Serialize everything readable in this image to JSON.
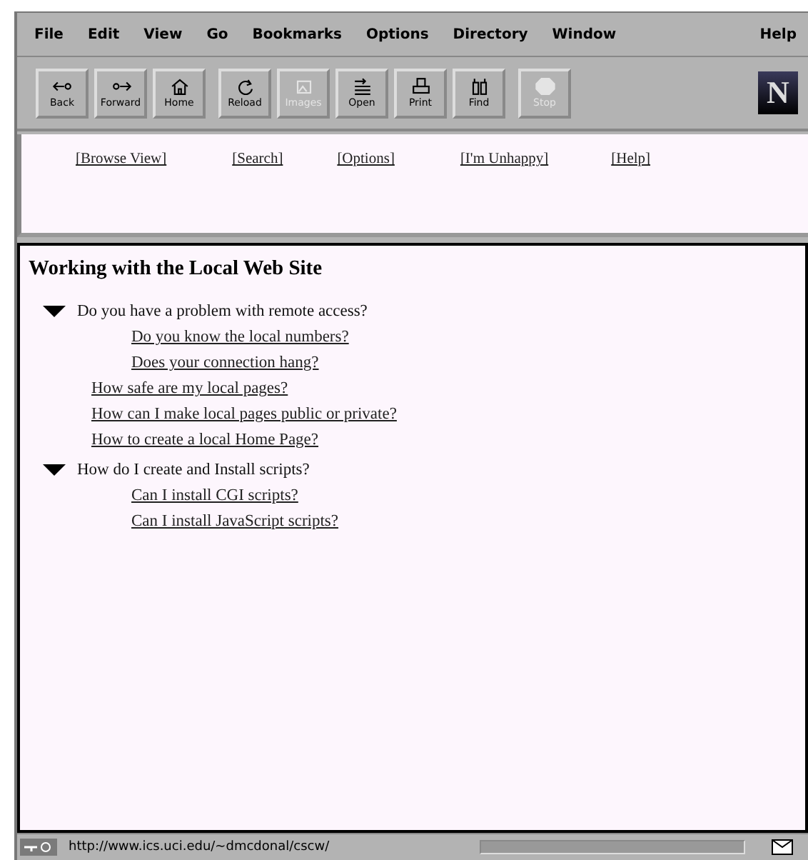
{
  "menu_bar": {
    "items": [
      "File",
      "Edit",
      "View",
      "Go",
      "Bookmarks",
      "Options",
      "Directory",
      "Window"
    ],
    "help": "Help"
  },
  "toolbar": {
    "groups": [
      [
        {
          "label": "Back",
          "kind": "back",
          "disabled": false
        },
        {
          "label": "Forward",
          "kind": "forward",
          "disabled": false
        },
        {
          "label": "Home",
          "kind": "home",
          "disabled": false
        }
      ],
      [
        {
          "label": "Reload",
          "kind": "reload",
          "disabled": false
        },
        {
          "label": "Images",
          "kind": "images",
          "disabled": true
        },
        {
          "label": "Open",
          "kind": "open",
          "disabled": false
        },
        {
          "label": "Print",
          "kind": "print",
          "disabled": false
        },
        {
          "label": "Find",
          "kind": "find",
          "disabled": false
        }
      ],
      [
        {
          "label": "Stop",
          "kind": "stop",
          "disabled": true
        }
      ]
    ],
    "logo": "N"
  },
  "nav_frame": {
    "links": [
      "[Browse View]",
      "[Search]",
      "[Options]",
      "[I'm Unhappy]",
      "[Help]"
    ]
  },
  "content": {
    "title": "Working with the Local Web Site",
    "outline": [
      {
        "kind": "section",
        "text": "Do you have a problem with remote access?",
        "expanded": true,
        "children": [
          {
            "kind": "link",
            "text": "Do you know the local numbers?"
          },
          {
            "kind": "link",
            "text": "Does your connection hang?"
          }
        ]
      },
      {
        "kind": "link",
        "text": "How safe are my local pages?"
      },
      {
        "kind": "link",
        "text": "How can I make local pages public or private?"
      },
      {
        "kind": "link",
        "text": "How to create a local Home Page?"
      },
      {
        "kind": "section",
        "text": "How do I create and Install scripts?",
        "expanded": true,
        "children": [
          {
            "kind": "link",
            "text": "Can I install CGI scripts?"
          },
          {
            "kind": "link",
            "text": "Can I install JavaScript scripts?"
          }
        ]
      }
    ]
  },
  "status_bar": {
    "url": "http://www.ics.uci.edu/~dmcdonal/cscw/",
    "progress": {
      "level": 0
    }
  }
}
